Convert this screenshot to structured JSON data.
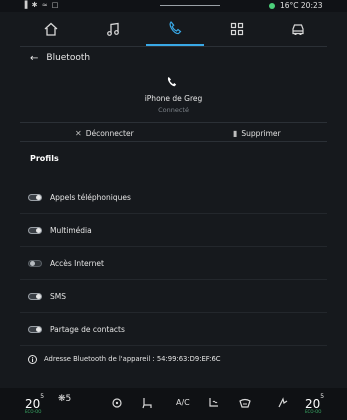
{
  "status_bar": {
    "left_icons": "▐ ✱ ≈ □",
    "temperature_time": "16°C  20:23",
    "status_dot_color": "#4cd07a"
  },
  "top_tabs": [
    {
      "name": "home-icon",
      "active": false
    },
    {
      "name": "music-icon",
      "active": false
    },
    {
      "name": "phone-icon",
      "active": true
    },
    {
      "name": "apps-grid-icon",
      "active": false
    },
    {
      "name": "car-icon",
      "active": false
    }
  ],
  "header": {
    "title": "Bluetooth"
  },
  "device": {
    "name": "iPhone de Greg",
    "status": "Connecté"
  },
  "actions": {
    "disconnect_label": "Déconnecter",
    "delete_label": "Supprimer"
  },
  "profiles": {
    "title": "Profils",
    "items": [
      {
        "label": "Appels téléphoniques",
        "on": true
      },
      {
        "label": "Multimédia",
        "on": true
      },
      {
        "label": "Accès Internet",
        "on": false
      },
      {
        "label": "SMS",
        "on": true
      },
      {
        "label": "Partage de contacts",
        "on": true
      }
    ]
  },
  "info": {
    "text": "Adresse Bluetooth de l'appareil : 54:99:63:D9:EF:6C"
  },
  "bottom_bar": {
    "left_temp": "20",
    "left_temp_unit": "5",
    "left_eco": "ECO-OO",
    "fan_level": "5",
    "ac_label": "A/C",
    "right_temp": "20",
    "right_temp_unit": "5",
    "right_eco": "ECO-OO"
  },
  "colors": {
    "accent": "#39a8e6",
    "background": "#16191d"
  }
}
